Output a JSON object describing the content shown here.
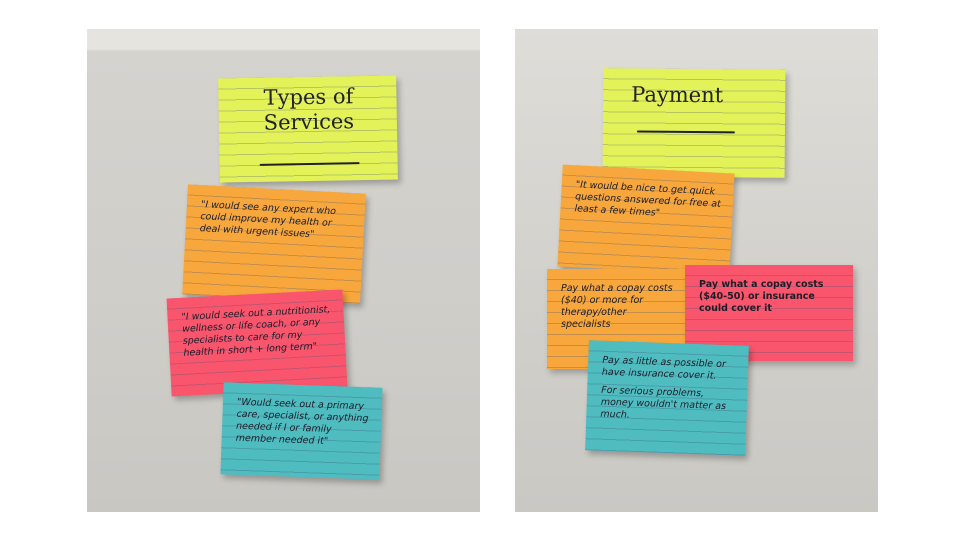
{
  "left_board": {
    "title": "Types of Services",
    "notes": [
      {
        "text": "\"I would see any expert who could improve my health or deal with urgent issues\"",
        "color": "#f8a73c"
      },
      {
        "text": "\"I would seek out a nutritionist, wellness or life coach, or any specialists to care for my health in short + long term\"",
        "color": "#f9556d"
      },
      {
        "text": "\"Would seek out a primary care, specialist, or anything needed if I or family member needed it\"",
        "color": "#4fbcc0"
      }
    ]
  },
  "right_board": {
    "title": "Payment",
    "notes": [
      {
        "text": "\"It would be nice to get quick questions answered for free at least a few times\"",
        "color": "#f8a73c"
      },
      {
        "text": "Pay what a copay costs ($40) or more for therapy/other specialists",
        "color": "#f8a73c"
      },
      {
        "text": "Pay what a copay costs ($40-50) or insurance could cover it",
        "color": "#f9556d"
      },
      {
        "text_1": "Pay as little as possible or have insurance cover it.",
        "text_2": "For serious problems, money wouldn't matter as much.",
        "color": "#4fbcc0"
      }
    ]
  }
}
